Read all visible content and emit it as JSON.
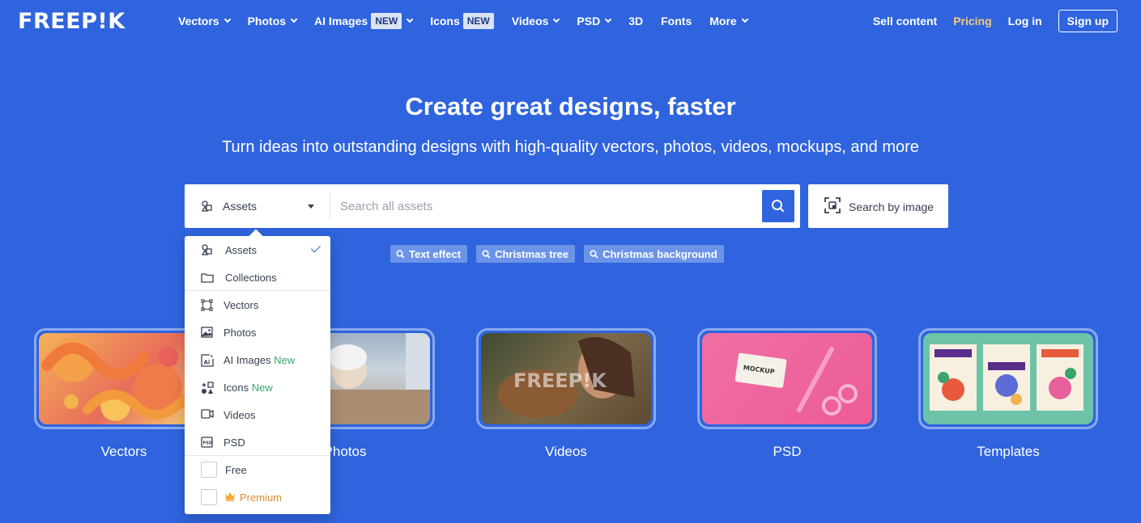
{
  "brand": {
    "logo_text": "FREEP!K"
  },
  "nav": {
    "items": [
      {
        "label": "Vectors",
        "has_menu": true
      },
      {
        "label": "Photos",
        "has_menu": true
      },
      {
        "label": "AI Images",
        "badge": "NEW",
        "has_menu": true
      },
      {
        "label": "Icons",
        "badge": "NEW",
        "has_menu": false
      },
      {
        "label": "Videos",
        "has_menu": true
      },
      {
        "label": "PSD",
        "has_menu": true
      },
      {
        "label": "3D",
        "has_menu": false
      },
      {
        "label": "Fonts",
        "has_menu": false
      },
      {
        "label": "More",
        "has_menu": true
      }
    ],
    "sell_content": "Sell content",
    "pricing": "Pricing",
    "login": "Log in",
    "signup": "Sign up"
  },
  "hero": {
    "title": "Create great designs, faster",
    "subtitle": "Turn ideas into outstanding designs with high-quality vectors, photos, videos, mockups, and more"
  },
  "search": {
    "selected_type": "Assets",
    "placeholder": "Search all assets",
    "image_search_label": "Search by image"
  },
  "dropdown": {
    "items": [
      {
        "label": "Assets",
        "icon": "assets-icon",
        "selected": true
      },
      {
        "label": "Collections",
        "icon": "folder-icon"
      },
      {
        "label": "Vectors",
        "icon": "vector-icon"
      },
      {
        "label": "Photos",
        "icon": "photo-icon"
      },
      {
        "label": "AI Images",
        "icon": "ai-image-icon",
        "tag": "New"
      },
      {
        "label": "Icons",
        "icon": "icons-icon",
        "tag": "New"
      },
      {
        "label": "Videos",
        "icon": "video-icon"
      },
      {
        "label": "PSD",
        "icon": "psd-icon"
      }
    ],
    "filters": [
      {
        "label": "Free",
        "checked": false
      },
      {
        "label": "Premium",
        "checked": false,
        "icon": "crown-icon"
      }
    ]
  },
  "tags": [
    "Text effect",
    "Christmas tree",
    "Christmas background"
  ],
  "categories": [
    {
      "label": "Vectors"
    },
    {
      "label": "Photos"
    },
    {
      "label": "Videos",
      "watermark": "FREEP!K"
    },
    {
      "label": "PSD"
    },
    {
      "label": "Templates"
    }
  ],
  "colors": {
    "background": "#2f64de",
    "accent": "#2f64de",
    "pricing": "#f6c97b",
    "new_tag": "#3aa56b",
    "premium": "#e38a2c"
  }
}
